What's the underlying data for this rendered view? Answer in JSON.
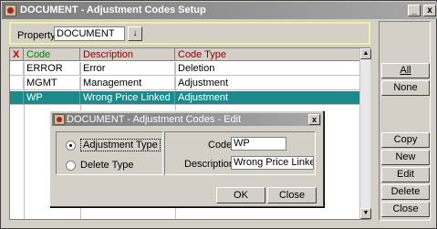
{
  "window": {
    "title": "DOCUMENT - Adjustment Codes Setup",
    "minimize_glyph": "_",
    "close_glyph": "x"
  },
  "property": {
    "label": "Property",
    "value": "DOCUMENT",
    "lov_glyph": "↓"
  },
  "grid": {
    "headers": {
      "x": "X",
      "code": "Code",
      "description": "Description",
      "code_type": "Code Type"
    },
    "rows": [
      {
        "code": "ERROR",
        "description": "Error",
        "code_type": "Deletion",
        "selected": false
      },
      {
        "code": "MGMT",
        "description": "Management",
        "code_type": "Adjustment",
        "selected": false
      },
      {
        "code": "WP",
        "description": "Wrong Price Linked",
        "code_type": "Adjustment",
        "selected": true
      }
    ],
    "scroll_up_glyph": "▲",
    "scroll_down_glyph": "▼"
  },
  "sidebar": {
    "all": "All",
    "none": "None",
    "copy": "Copy",
    "new": "New",
    "edit": "Edit",
    "delete": "Delete",
    "close": "Close"
  },
  "dialog": {
    "title": "DOCUMENT - Adjustment Codes - Edit",
    "close_glyph": "x",
    "radio_adjustment": "Adjustment Type",
    "radio_delete": "Delete Type",
    "selected_radio": "adjustment",
    "code_label": "Code",
    "code_value": "WP",
    "description_label": "Description",
    "description_value": "Wrong Price Linked",
    "ok": "OK",
    "close": "Close"
  }
}
